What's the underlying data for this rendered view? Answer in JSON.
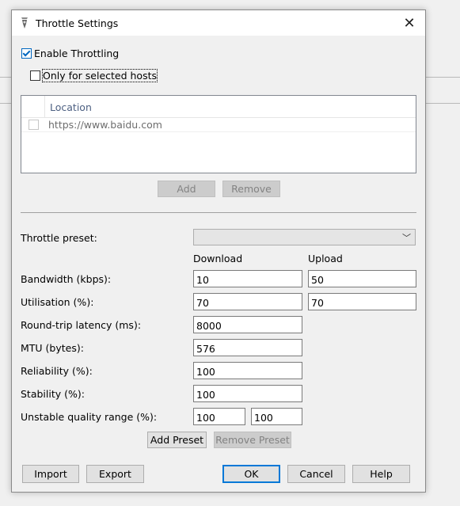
{
  "window": {
    "title": "Throttle Settings",
    "close_glyph": "✕"
  },
  "throttling": {
    "enable_label": "Enable Throttling",
    "enable_checked": true,
    "selected_hosts_label": "Only for selected hosts",
    "selected_hosts_checked": false
  },
  "hosts": {
    "column_header": "Location",
    "rows": [
      "https://www.baidu.com"
    ],
    "add_label": "Add",
    "remove_label": "Remove"
  },
  "preset": {
    "label": "Throttle preset:",
    "value": ""
  },
  "columns": {
    "download": "Download",
    "upload": "Upload"
  },
  "fields": {
    "bandwidth": {
      "label": "Bandwidth (kbps):",
      "download": "10",
      "upload": "50"
    },
    "utilisation": {
      "label": "Utilisation (%):",
      "download": "70",
      "upload": "70"
    },
    "latency": {
      "label": "Round-trip latency (ms):",
      "value": "8000"
    },
    "mtu": {
      "label": "MTU (bytes):",
      "value": "576"
    },
    "reliability": {
      "label": "Reliability (%):",
      "value": "100"
    },
    "stability": {
      "label": "Stability (%):",
      "value": "100"
    },
    "unstable_range": {
      "label": "Unstable quality range (%):",
      "min": "100",
      "max": "100"
    }
  },
  "preset_buttons": {
    "add": "Add Preset",
    "remove": "Remove Preset"
  },
  "footer": {
    "import": "Import",
    "export": "Export",
    "ok": "OK",
    "cancel": "Cancel",
    "help": "Help"
  },
  "colors": {
    "accent": "#0078d7",
    "checkbox_accent": "#0067c0"
  }
}
